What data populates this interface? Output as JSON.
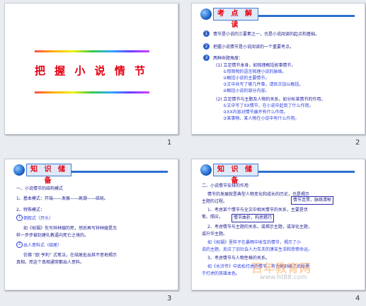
{
  "slide1": {
    "number": "1",
    "title": "把 握 小 说 情 节"
  },
  "slide2": {
    "number": "2",
    "header": "考 点 解 读",
    "items": [
      {
        "num": "1",
        "text": "情节是小说的三要素之一，也是小说阅读的起点和基础。"
      },
      {
        "num": "2",
        "text": "把握小说情节是小说阅读的一个重要考点。"
      },
      {
        "num": "3",
        "text": "两种命题角度："
      }
    ],
    "sub1_label": "(1) 立足情节本身，如梳理概括故事情节，",
    "sub1_lines": [
      "①用简明的语言梳理小说的脉络。",
      "②概括小说的主要情节。",
      "③文中共写了哪几件事，请依次加以概括。",
      "④概括小说的部分内容。"
    ],
    "sub2_label": "(2) 立足情节与主题及人物的关系，如分析某情节的作用。",
    "sub2_lines": [
      "①文中写了XX情节，在小说中起到了什么作用。",
      "②XX内容对情节展开有什么作用。",
      "③某事物、某人物在小说中有什么作用。"
    ]
  },
  "slide3": {
    "number": "3",
    "header": "知 识 储 备",
    "lines": [
      "一、小说情节的结构模式",
      "1、基本模式：开端——发展——高潮——结局。",
      "2、特殊模式：",
      "倒叙式（开头）",
      "如《祝福》先写祥林嫂的死，然后再写祥林嫂是怎",
      "样一步步被封建礼教逼向死亡之境的。",
      "出人意料式（结尾）",
      "仿佛 “欧·亨利” 式笔法，在结尾处出其不意地揭示",
      "真相，而这个真相通常都出人意料。"
    ]
  },
  "slide4": {
    "number": "4",
    "header": "知 识 储 备",
    "lines": [
      "二、小说情节安排的作用",
      "情节的发展就是典型人物变化和成长的历史，也是揭示",
      "主题的过程。",
      "1、考虑某个情节与全文中相关情节的关系，主要是伏",
      "笔、照应，",
      "2、考虑情节与主题的关系，或揭示主题，或深化主题，",
      "或升华主题。",
      "如《祝福》里样子在暴雨中收车的情节，揭示了小",
      "说的主题，反应了旧社会人力车夫的凄苦生活和悲惨命运。",
      "3、考虑情节与人物性格的关系。",
      "如《水浒传》中武松打虎的情节，有力地刻画了武松勇",
      "于打虎的英雄本色。"
    ],
    "callout1": "情节连贯，脉络清晰",
    "callout2": "情节曲折，构思精巧",
    "watermark": "百年教育网",
    "watermark_url": "www.ht88.com"
  }
}
